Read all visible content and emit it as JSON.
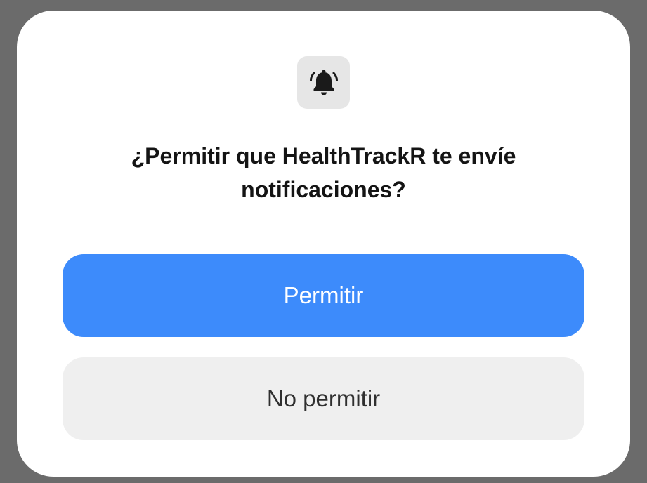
{
  "dialog": {
    "icon": "bell-ringing-icon",
    "title": "¿Permitir que HealthTrackR te envíe notificaciones?",
    "allow_label": "Permitir",
    "deny_label": "No permitir"
  },
  "colors": {
    "primary": "#3d8bfb",
    "secondary": "#efefef",
    "backdrop": "#6b6b6b",
    "icon_tile": "#e6e6e6"
  }
}
